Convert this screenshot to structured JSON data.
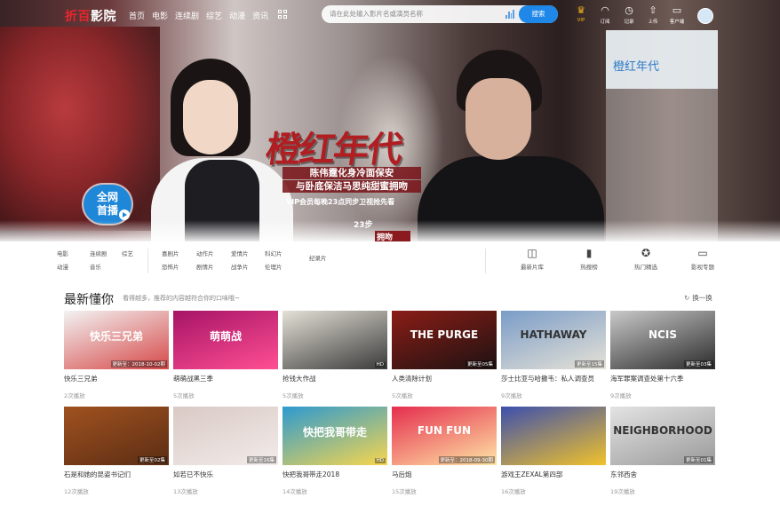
{
  "nav": {
    "logo_brand": "折百",
    "logo_rest": "影院",
    "links": [
      "首页",
      "电影",
      "连续剧",
      "综艺",
      "动漫",
      "资讯"
    ],
    "search_placeholder": "请在此处输入影片名或演员名称",
    "search_button": "搜索",
    "tools": [
      {
        "icon": "vip-crown-icon",
        "label": "VIP"
      },
      {
        "icon": "subscribe-icon",
        "label": "订阅"
      },
      {
        "icon": "history-icon",
        "label": "记录"
      },
      {
        "icon": "upload-icon",
        "label": "上传"
      },
      {
        "icon": "client-icon",
        "label": "客户端"
      }
    ]
  },
  "hero": {
    "title": "橙红年代",
    "sub_line1": "陈伟霆化身冷面保安",
    "sub_line2": "与卧底保洁马思纯甜蜜拥吻",
    "sub_line3": "VIP会员每晚23点同步卫视抢先看",
    "live_badge_line1": "全网",
    "live_badge_line2": "首播",
    "side_title": "橙红年代",
    "mini_a": "23步",
    "mini_b": "拥吻"
  },
  "categories": {
    "group1": [
      "电影",
      "连续剧",
      "综艺",
      "动漫",
      "音乐"
    ],
    "group2": [
      "喜剧片",
      "动作片",
      "爱情片",
      "科幻片",
      "恐怖片",
      "剧情片",
      "战争片",
      "伦理片"
    ],
    "extra": "纪录片",
    "quick": [
      {
        "icon": "film-library-icon",
        "label": "最新片库"
      },
      {
        "icon": "hot-chart-icon",
        "label": "热搜榜"
      },
      {
        "icon": "hot-pick-icon",
        "label": "热门精选"
      },
      {
        "icon": "topic-icon",
        "label": "影视专题"
      }
    ]
  },
  "section": {
    "title": "最新懂你",
    "subtitle": "看得越多，推荐的内容越符合你的口味哦~",
    "refresh": "换一换"
  },
  "movies": [
    {
      "title": "快乐三兄弟",
      "plays": "2次播放",
      "badge": "更新至：2018-10-02期",
      "colors": [
        "#f3f3f3",
        "#d64848"
      ]
    },
    {
      "title": "萌萌战黑三季",
      "plays": "5次播放",
      "badge": "",
      "colors": [
        "#a61466",
        "#ff4f93"
      ]
    },
    {
      "title": "抢钱大作战",
      "plays": "5次播放",
      "badge": "HD",
      "colors": [
        "#e4e1d6",
        "#3a3a3a"
      ]
    },
    {
      "title": "人类清除计划",
      "plays": "5次播放",
      "badge": "更新至05集",
      "colors": [
        "#8b1d16",
        "#1d1212"
      ]
    },
    {
      "title": "莎士比亚与哈撒韦：私人调查员",
      "plays": "9次播放",
      "badge": "更新至15集",
      "colors": [
        "#7a9cc8",
        "#e6e2d6"
      ]
    },
    {
      "title": "海军罪案调查处第十六季",
      "plays": "9次播放",
      "badge": "更新至03集",
      "colors": [
        "#c9c9c9",
        "#2b2b2b"
      ]
    },
    {
      "title": "石是和她的昆姿书记们",
      "plays": "12次播放",
      "badge": "更新至02集",
      "colors": [
        "#a0521f",
        "#5b2d14"
      ]
    },
    {
      "title": "如若已不快乐",
      "plays": "13次播放",
      "badge": "更新至16集",
      "colors": [
        "#d9c9c4",
        "#f2ecea"
      ]
    },
    {
      "title": "快把我哥带走2018",
      "plays": "14次播放",
      "badge": "HD",
      "colors": [
        "#2d9ad0",
        "#f7d64d"
      ]
    },
    {
      "title": "马后炮",
      "plays": "15次播放",
      "badge": "更新至：2018-09-30期",
      "colors": [
        "#e52d4d",
        "#ffe6a6"
      ]
    },
    {
      "title": "游戏王ZEXAL第四部",
      "plays": "16次播放",
      "badge": "",
      "colors": [
        "#3c4fae",
        "#f1c22b"
      ]
    },
    {
      "title": "东邻西舍",
      "plays": "19次播放",
      "badge": "更新至01集",
      "colors": [
        "#e3e3e3",
        "#9a9a9a"
      ]
    }
  ],
  "poster_text": {
    "p1": "快乐三兄弟",
    "p2": "萌萌战",
    "p4": "THE PURGE",
    "p5": "HATHAWAY",
    "p6": "NCIS",
    "p9": "快把我哥带走",
    "p10": "FUN FUN",
    "p12": "NEIGHBORHOOD"
  }
}
